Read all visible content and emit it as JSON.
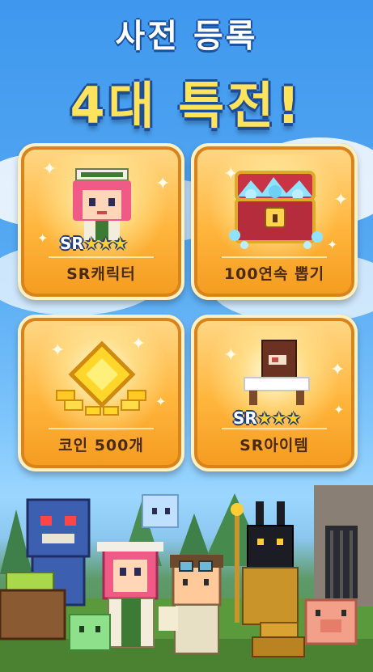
{
  "header": {
    "line1": "사전 등록",
    "line2": "4대 특전!"
  },
  "rewards": [
    {
      "label": "SR캐릭터",
      "badge": "SR",
      "stars": "★★★",
      "icon": "character-icon"
    },
    {
      "label": "100연속 뽑기",
      "icon": "treasure-chest-icon"
    },
    {
      "label": "코인 500개",
      "icon": "coin-icon"
    },
    {
      "label": "SR아이템",
      "badge": "SR",
      "stars": "★★★",
      "icon": "item-icon"
    }
  ],
  "colors": {
    "sky_top": "#3f98ee",
    "title_white": "#ffffff",
    "title_yellow": "#ffe35a",
    "card_gold": "#ffb53c",
    "label_brown": "#4a2a10"
  }
}
